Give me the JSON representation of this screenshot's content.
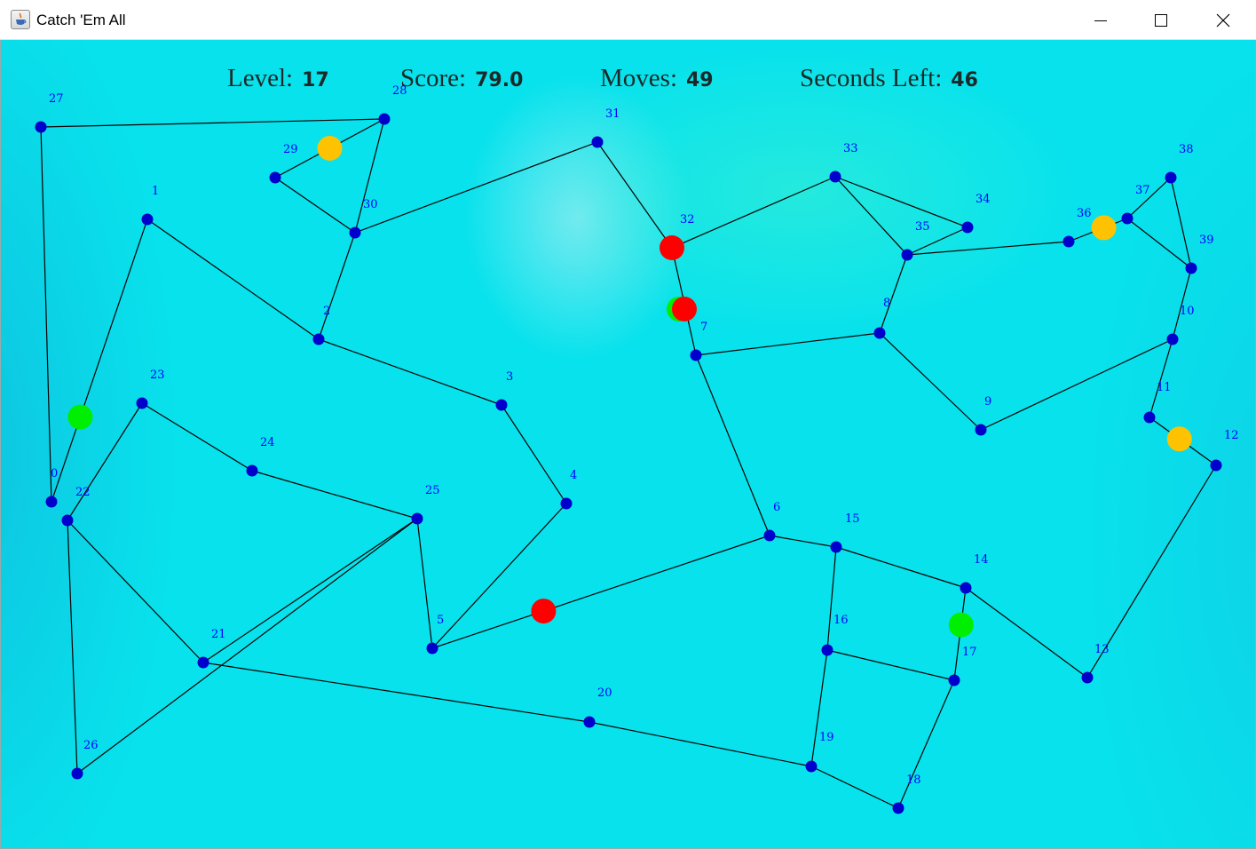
{
  "window": {
    "title": "Catch 'Em All",
    "icons": {
      "app": "java-cup-icon",
      "minimize": "minimize-icon",
      "maximize": "maximize-icon",
      "close": "close-icon"
    }
  },
  "hud": {
    "level_label": "Level:",
    "level_value": "17",
    "score_label": "Score:",
    "score_value": "79.0",
    "moves_label": "Moves:",
    "moves_value": "49",
    "seconds_label": "Seconds Left:",
    "seconds_value": "46"
  },
  "colors": {
    "node": "#0000cc",
    "edge": "#000000",
    "node_label": "#0000ff",
    "red_piece": "#ff0000",
    "green_piece": "#00ee00",
    "yellow_piece": "#ffc200"
  },
  "graph": {
    "nodes": [
      {
        "id": "0"
      },
      {
        "id": "1"
      },
      {
        "id": "2"
      },
      {
        "id": "3"
      },
      {
        "id": "4"
      },
      {
        "id": "5"
      },
      {
        "id": "6"
      },
      {
        "id": "7"
      },
      {
        "id": "8"
      },
      {
        "id": "9"
      },
      {
        "id": "10"
      },
      {
        "id": "11"
      },
      {
        "id": "12"
      },
      {
        "id": "13"
      },
      {
        "id": "14"
      },
      {
        "id": "15"
      },
      {
        "id": "16"
      },
      {
        "id": "17"
      },
      {
        "id": "18"
      },
      {
        "id": "19"
      },
      {
        "id": "20"
      },
      {
        "id": "21"
      },
      {
        "id": "22"
      },
      {
        "id": "23"
      },
      {
        "id": "24"
      },
      {
        "id": "25"
      },
      {
        "id": "26"
      },
      {
        "id": "27"
      },
      {
        "id": "28"
      },
      {
        "id": "29"
      },
      {
        "id": "30"
      },
      {
        "id": "31"
      },
      {
        "id": "32"
      },
      {
        "id": "33"
      },
      {
        "id": "34"
      },
      {
        "id": "35"
      },
      {
        "id": "36"
      },
      {
        "id": "37"
      },
      {
        "id": "38"
      },
      {
        "id": "39"
      }
    ],
    "edges": [
      [
        "0",
        "1"
      ],
      [
        "0",
        "27"
      ],
      [
        "1",
        "2"
      ],
      [
        "2",
        "30"
      ],
      [
        "2",
        "3"
      ],
      [
        "3",
        "4"
      ],
      [
        "4",
        "5"
      ],
      [
        "5",
        "25"
      ],
      [
        "5",
        "6"
      ],
      [
        "6",
        "7"
      ],
      [
        "6",
        "15"
      ],
      [
        "7",
        "32"
      ],
      [
        "7",
        "8"
      ],
      [
        "8",
        "35"
      ],
      [
        "8",
        "9"
      ],
      [
        "9",
        "10"
      ],
      [
        "10",
        "11"
      ],
      [
        "10",
        "39"
      ],
      [
        "11",
        "12"
      ],
      [
        "12",
        "13"
      ],
      [
        "13",
        "14"
      ],
      [
        "14",
        "15"
      ],
      [
        "14",
        "17"
      ],
      [
        "15",
        "16"
      ],
      [
        "16",
        "17"
      ],
      [
        "16",
        "19"
      ],
      [
        "17",
        "18"
      ],
      [
        "18",
        "19"
      ],
      [
        "19",
        "20"
      ],
      [
        "20",
        "21"
      ],
      [
        "21",
        "22"
      ],
      [
        "21",
        "25"
      ],
      [
        "22",
        "23"
      ],
      [
        "22",
        "26"
      ],
      [
        "23",
        "24"
      ],
      [
        "24",
        "25"
      ],
      [
        "25",
        "26"
      ],
      [
        "27",
        "28"
      ],
      [
        "28",
        "29"
      ],
      [
        "28",
        "30"
      ],
      [
        "29",
        "30"
      ],
      [
        "30",
        "31"
      ],
      [
        "31",
        "32"
      ],
      [
        "32",
        "33"
      ],
      [
        "33",
        "34"
      ],
      [
        "33",
        "35"
      ],
      [
        "34",
        "35"
      ],
      [
        "35",
        "36"
      ],
      [
        "36",
        "37"
      ],
      [
        "37",
        "38"
      ],
      [
        "37",
        "39"
      ],
      [
        "38",
        "39"
      ]
    ],
    "pieces": [
      {
        "color": "green",
        "on": "7"
      },
      {
        "color": "red",
        "on": "32"
      },
      {
        "color": "red",
        "on": "7"
      },
      {
        "color": "green",
        "on": "0-1",
        "t": 0.3
      },
      {
        "color": "yellow",
        "on": "28-29",
        "t": 0.5
      },
      {
        "color": "red",
        "on": "5-6",
        "t": 0.33
      },
      {
        "color": "green",
        "on": "14-17",
        "t": 0.4
      },
      {
        "color": "yellow",
        "on": "36-37",
        "t": 0.6
      },
      {
        "color": "yellow",
        "on": "11-12",
        "t": 0.45
      }
    ]
  }
}
